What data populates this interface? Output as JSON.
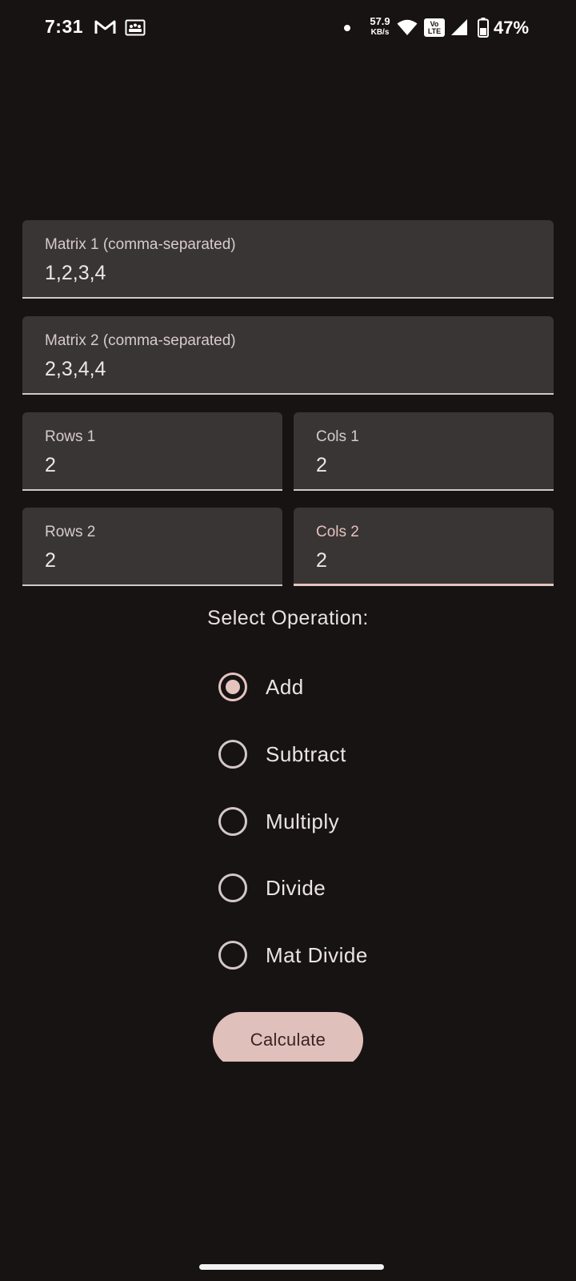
{
  "status_bar": {
    "time": "7:31",
    "net_speed_value": "57.9",
    "net_speed_unit": "KB/s",
    "volte_top": "Vo",
    "volte_bottom": "LTE",
    "battery_percent": "47%",
    "icons": [
      "gmail-icon",
      "teams-icon",
      "dot-icon",
      "wifi-icon",
      "volte-icon",
      "signal-icon",
      "battery-icon"
    ]
  },
  "fields": {
    "matrix1": {
      "label": "Matrix 1 (comma-separated)",
      "value": "1,2,3,4"
    },
    "matrix2": {
      "label": "Matrix 2 (comma-separated)",
      "value": "2,3,4,4"
    },
    "rows1": {
      "label": "Rows 1",
      "value": "2"
    },
    "cols1": {
      "label": "Cols 1",
      "value": "2"
    },
    "rows2": {
      "label": "Rows 2",
      "value": "2"
    },
    "cols2": {
      "label": "Cols 2",
      "value": "2",
      "focused": true
    }
  },
  "operation": {
    "title": "Select Operation:",
    "options": [
      {
        "label": "Add",
        "checked": true
      },
      {
        "label": "Subtract",
        "checked": false
      },
      {
        "label": "Multiply",
        "checked": false
      },
      {
        "label": "Divide",
        "checked": false
      },
      {
        "label": "Mat Divide",
        "checked": false
      }
    ]
  },
  "calculate_label": "Calculate",
  "colors": {
    "background": "#171313",
    "field_background": "#3a3535",
    "accent": "#e5c4bf",
    "button": "#e0c0bb",
    "button_text": "#3b2422"
  }
}
